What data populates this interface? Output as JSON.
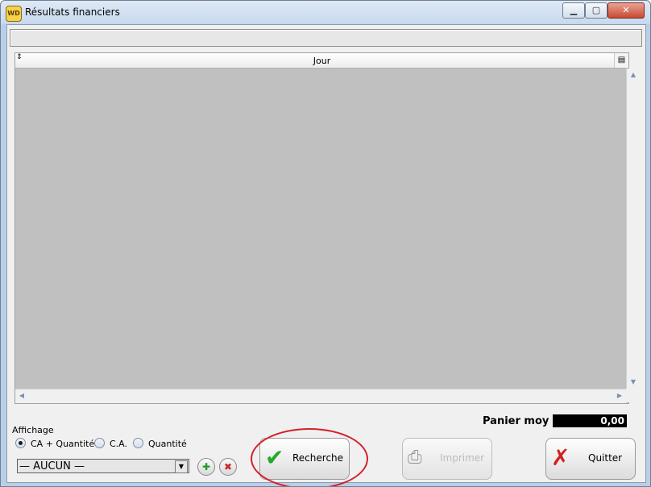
{
  "window": {
    "title": "Résultats financiers",
    "icon_text": "WD"
  },
  "grid": {
    "column_header": "Jour"
  },
  "affichage": {
    "label": "Affichage",
    "options": [
      {
        "label": "CA + Quantité",
        "selected": true
      },
      {
        "label": "C.A.",
        "selected": false
      },
      {
        "label": "Quantité",
        "selected": false
      }
    ]
  },
  "filter": {
    "selected": "— AUCUN —"
  },
  "buttons": {
    "search": "Recherche",
    "print": "Imprimer",
    "quit": "Quitter"
  },
  "panier": {
    "label": "Panier moy",
    "value": "0,00"
  },
  "colors": {
    "title_bg": "#c8daef",
    "close_red": "#c84a33",
    "grid_bg": "#c0c0c0",
    "annotation_red": "#d3202a",
    "check_green": "#23a92c"
  }
}
